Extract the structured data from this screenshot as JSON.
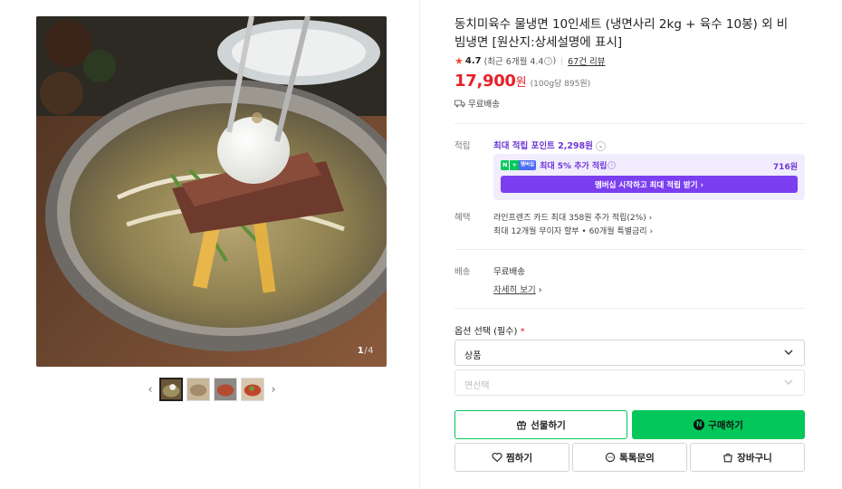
{
  "gallery": {
    "counter_current": "1",
    "counter_total": "/4",
    "prev_arrow": "‹",
    "next_arrow": "›"
  },
  "product": {
    "title": "동치미육수 물냉면 10인세트 (냉면사리 2kg + 육수 10봉) 외 비빔냉면 [원산지:상세설명에 표시]",
    "rating": "4.7",
    "recent_rating": "(최근 6개월 4.4",
    "recent_rating_close": ")",
    "review_count": "67건 리뷰",
    "price": "17,900",
    "currency": "원",
    "unit_price": "(100g당 895원)",
    "shipping_badge": "무료배송"
  },
  "points": {
    "label": "적립",
    "max_points": "최대 적립 포인트 2,298원",
    "promo_badge_n": "N",
    "promo_badge_plus": "+",
    "promo_badge_tag": "멤버십",
    "promo_text": "최대 5% 추가 적립",
    "promo_amount": "716원",
    "promo_button": "멤버십 시작하고 최대 적립 받기 ›"
  },
  "benefits": {
    "label": "혜택",
    "line1": "라인프렌즈 카드 최대 358원 추가 적립(2%) ›",
    "line2": "최대 12개월 무이자 할부 • 60개월 특별금리 ›"
  },
  "delivery": {
    "label": "배송",
    "value": "무료배송",
    "detail_link": "자세히 보기",
    "detail_arrow": "›"
  },
  "options": {
    "label": "옵션 선택 (필수)",
    "required_mark": "*",
    "select1": "상품",
    "select2_placeholder": "면선택"
  },
  "actions": {
    "gift": "선물하기",
    "buy": "구매하기",
    "npay_mark": "N",
    "wish": "찜하기",
    "talk": "톡톡문의",
    "cart": "장바구니"
  },
  "colors": {
    "price_red": "#e5212a",
    "naver_green": "#03c75a",
    "membership_purple": "#7b3ff0"
  }
}
